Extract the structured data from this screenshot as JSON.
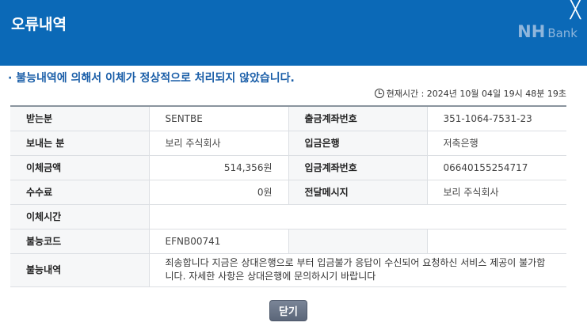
{
  "header": {
    "title": "오류내역",
    "close_icon": "close-icon",
    "logo": "NH",
    "logo_sub": "Bank",
    "bg_color": "#0b69b7"
  },
  "message": "· 불능내역에 의해서 이체가 정상적으로 처리되지 않았습니다.",
  "current_time": "현재시간 : 2024년 10월 04일 19시 48분 19초",
  "rows": [
    {
      "label1": "받는분",
      "value1": "SENTBE",
      "label2": "출금계좌번호",
      "value2": "351-1064-7531-23"
    },
    {
      "label1": "보내는 분",
      "value1": "보리 주식회사",
      "label2": "입금은행",
      "value2": "저축은행"
    },
    {
      "label1": "이체금액",
      "value1": "514,356원",
      "label2": "입금계좌번호",
      "value2": "06640155254717"
    },
    {
      "label1": "수수료",
      "value1": "0원",
      "label2": "전달메시지",
      "value2": "보리 주식회사"
    },
    {
      "label1": "이체시간",
      "value1": ""
    },
    {
      "label1": "불능코드",
      "value1": "EFNB00741",
      "label2": "",
      "value2": ""
    },
    {
      "label1": "불능내역",
      "value1": "죄송합니다 지금은 상대은행으로 부터 입금불가 응답이 수신되어 요청하신 서비스 제공이 불가합니다. 자세한 사항은 상대은행에 문의하시기 바랍니다"
    }
  ],
  "close_button": "닫기"
}
